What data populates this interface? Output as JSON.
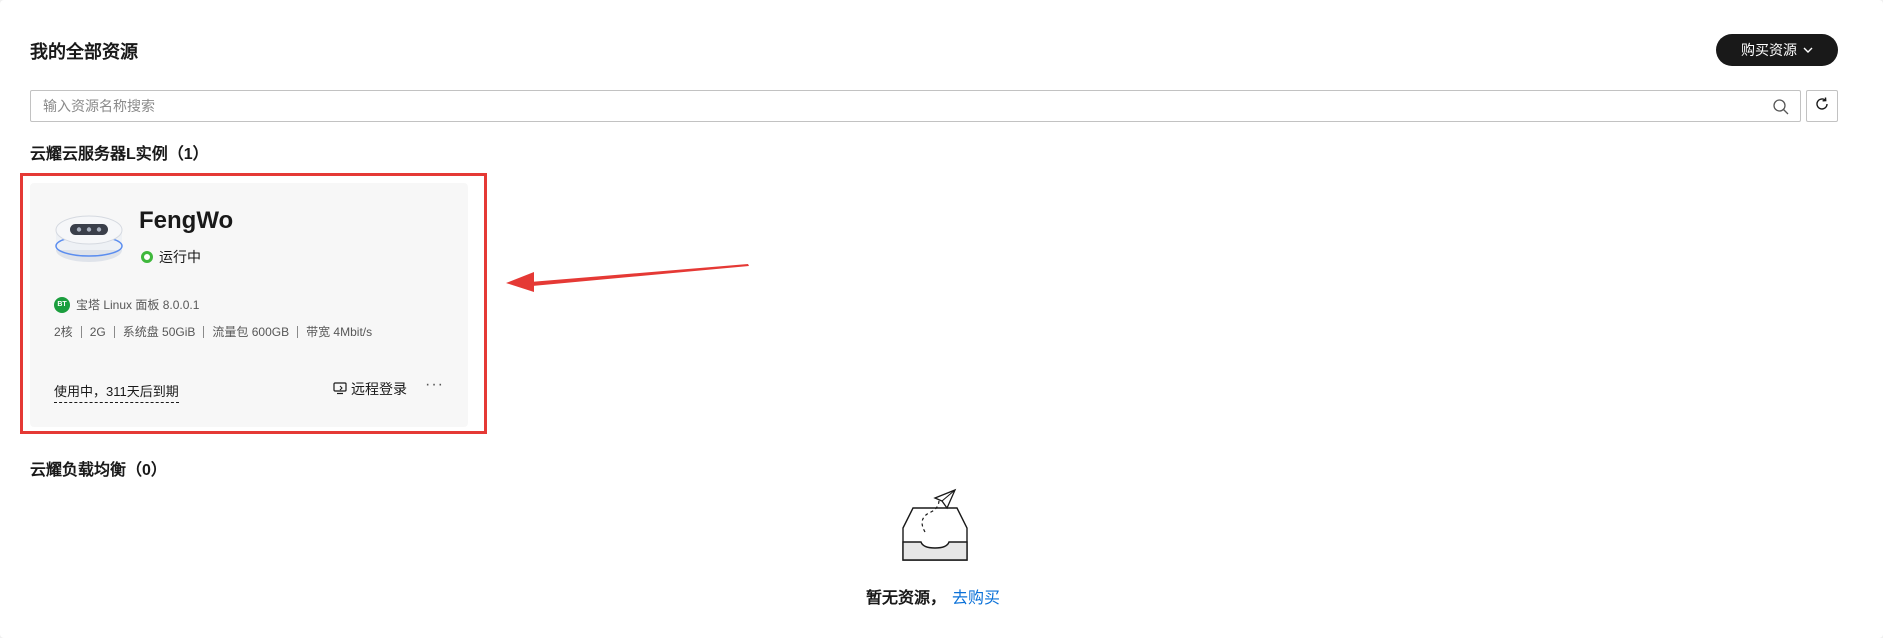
{
  "header": {
    "title": "我的全部资源",
    "buy_button_label": "购买资源"
  },
  "search": {
    "placeholder": "输入资源名称搜索",
    "value": ""
  },
  "sections": [
    {
      "title": "云耀云服务器L实例（1）",
      "instances": [
        {
          "name": "FengWo",
          "status": "运行中",
          "image_badge": "BT",
          "image": "宝塔 Linux 面板 8.0.0.1",
          "specs": [
            "2核",
            "2G",
            "系统盘 50GiB",
            "流量包 600GB",
            "带宽 4Mbit/s"
          ],
          "expire_text": "使用中，311天后到期",
          "remote_login_label": "远程登录",
          "more_label": "···"
        }
      ]
    },
    {
      "title": "云耀负载均衡（0）",
      "empty": {
        "message": "暂无资源，",
        "link_label": "去购买"
      }
    }
  ],
  "colors": {
    "status_running": "#3fb83c",
    "annotation_red": "#e53935",
    "link_blue": "#0b71d8",
    "button_dark": "#191919"
  },
  "icons": [
    "chevron-down-icon",
    "search-icon",
    "refresh-icon",
    "server-instance-icon",
    "remote-login-icon",
    "more-icon",
    "empty-inbox-icon"
  ]
}
